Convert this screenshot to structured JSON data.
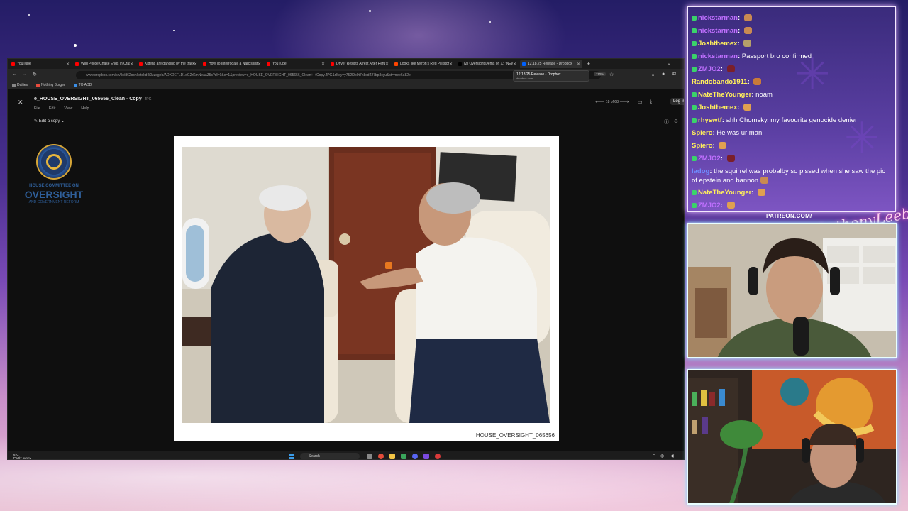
{
  "browser": {
    "tabs": [
      {
        "label": "YouTube",
        "color": "#ff0000",
        "active": false
      },
      {
        "label": "Wild Police Chase Ends in Crash",
        "color": "#ff0000",
        "active": false
      },
      {
        "label": "Kittens are dancing by the track",
        "color": "#ff0000",
        "active": false
      },
      {
        "label": "How To Interrogate a Narcissist",
        "color": "#ff0000",
        "active": false
      },
      {
        "label": "YouTube",
        "color": "#ff0000",
        "active": false
      },
      {
        "label": "Driver Resists Arrest After Refusi",
        "color": "#ff0000",
        "active": false
      },
      {
        "label": "Looks like Myron's Red Pill stor",
        "color": "#ff4500",
        "active": false
      },
      {
        "label": "(2) Oversight Dems on X: \"NEW",
        "color": "#000000",
        "active": false
      },
      {
        "label": "12.18.25 Release - Dropbox",
        "color": "#0061fe",
        "active": true
      }
    ],
    "new_tab": "+",
    "tab_menu": "⌄",
    "url": "www.dropbox.com/sh/ilo/d62ochkdtdkd4i0zzqgeb/ADXDEFLD1oG2rKmNeaaZ5s?dl=0&e=1&preview=e_HOUSE_OVERSIGHT_065656_Clean+-+Copy.JPG&rlkey=y752l9o9t7n8sd427bp3cyu&st=mee6a82e",
    "zoom": "110%",
    "bookmarks": [
      {
        "label": "Dailies",
        "color": "#888888"
      },
      {
        "label": "Nothing Burger",
        "color": "#e84c3d"
      },
      {
        "label": "TO ADD",
        "color": "#3a8ee6"
      }
    ],
    "tooltip": {
      "title": "12.18.25 Release - Dropbox",
      "subtitle": "dropbox.com"
    }
  },
  "viewer": {
    "close": "✕",
    "filename": "e_HOUSE_OVERSIGHT_065656_Clean - Copy",
    "filetype": "JPG",
    "menu": [
      "File",
      "Edit",
      "View",
      "Help"
    ],
    "edit_copy": "✎ Edit a copy ⌄",
    "pager": "🡐  18 of 68  🡒",
    "login": "Log In",
    "logo": {
      "line1": "HOUSE COMMITTEE ON",
      "line2": "OVERSIGHT",
      "line3": "AND GOVERNMENT REFORM"
    },
    "photo_caption": "HOUSE_OVERSIGHT_065656"
  },
  "taskbar": {
    "weather_temp": "6°C",
    "weather_desc": "Partly sunny",
    "search": "Search"
  },
  "chat": {
    "messages": [
      {
        "user": "nickstarman",
        "user_color": "#c070ff",
        "text": "",
        "badge": "#3ad36a",
        "emote": "#c98a52"
      },
      {
        "user": "nickstarman",
        "user_color": "#c070ff",
        "text": "",
        "badge": "#3ad36a",
        "emote": "#c98a52"
      },
      {
        "user": "Joshthemex",
        "user_color": "#ffef5c",
        "text": "",
        "badge": "#3ad36a",
        "emote": "#b5a06a"
      },
      {
        "user": "nickstarman",
        "user_color": "#c070ff",
        "text": "Passport bro confirmed",
        "badge": "#3ad36a",
        "emote": ""
      },
      {
        "user": "ZMJO2",
        "user_color": "#c070ff",
        "text": "",
        "badge": "#3ad36a",
        "emote": "#7a1f2a"
      },
      {
        "user": "Randobando1911",
        "user_color": "#ffef5c",
        "text": "",
        "badge": "",
        "emote": "#c97a3a"
      },
      {
        "user": "NateTheYounger",
        "user_color": "#ffef5c",
        "text": "noam",
        "badge": "#3ad36a",
        "emote": ""
      },
      {
        "user": "Joshthemex",
        "user_color": "#ffef5c",
        "text": "",
        "badge": "#3ad36a",
        "emote": "#e0a050"
      },
      {
        "user": "rhyswtf",
        "user_color": "#ffef5c",
        "text": "ahh Chomsky, my favourite genocide denier",
        "badge": "#3ad36a",
        "emote": ""
      },
      {
        "user": "Spiero",
        "user_color": "#ffef5c",
        "text": "He was ur man",
        "badge": "",
        "emote": ""
      },
      {
        "user": "Spiero",
        "user_color": "#ffef5c",
        "text": "",
        "badge": "",
        "emote": "#e0a050"
      },
      {
        "user": "ZMJO2",
        "user_color": "#c070ff",
        "text": "",
        "badge": "#3ad36a",
        "emote": "#7a1f2a"
      },
      {
        "user": "ladog",
        "user_color": "#6f8cff",
        "text": "the squirrel was probalby so pissed when she saw the pic of epstein and bannon",
        "badge": "",
        "emote": "#c98a52",
        "wrap": true
      },
      {
        "user": "NateTheYounger",
        "user_color": "#ffef5c",
        "text": "",
        "badge": "#3ad36a",
        "emote": "#e0a050"
      },
      {
        "user": "ZMJO2",
        "user_color": "#c070ff",
        "text": "",
        "badge": "#3ad36a",
        "emote": "#e0a050"
      }
    ]
  },
  "overlay": {
    "patreon": "PATREON.COM/",
    "signature": "AnthonyLeeber"
  }
}
